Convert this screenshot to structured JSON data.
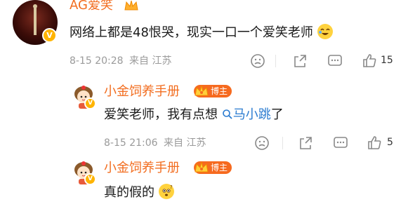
{
  "comments": [
    {
      "author": "AG爱笑",
      "text": "网络上都是48恨哭，现实一口一个爱笑老师",
      "time": "8-15 20:28",
      "location": "来自 江苏",
      "like_count": "15"
    }
  ],
  "replies": [
    {
      "author": "小金饲养手册",
      "role_badge": "博主",
      "text": "爱笑老师，我有点想",
      "mention": "马小跳",
      "text_after_mention": "了",
      "time": "8-15 21:06",
      "location": "来自 江苏",
      "like_count": "5"
    },
    {
      "author": "小金饲养手册",
      "role_badge": "博主",
      "text": "真的假的"
    }
  ],
  "icons": [
    "sad-emoji-icon",
    "share-icon",
    "comment-icon",
    "like-icon",
    "laughing-emoji-icon",
    "search-icon",
    "thinking-emoji-icon"
  ],
  "colors": {
    "author": "#f26d1f",
    "mention": "#2a7bd0",
    "meta": "#9a9a9a",
    "badge": "#f66a1f"
  }
}
